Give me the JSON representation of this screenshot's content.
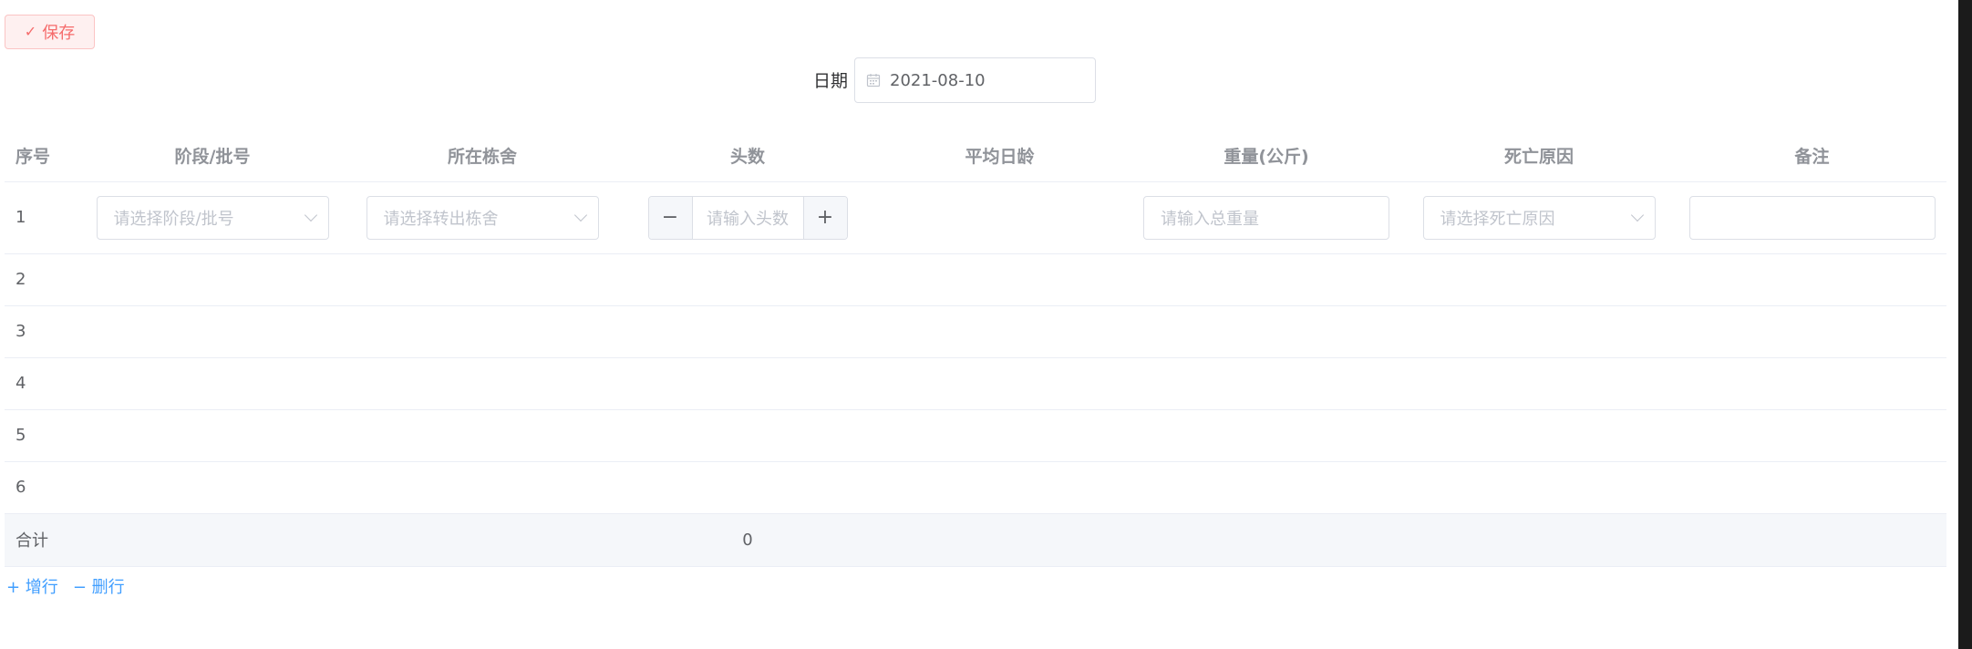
{
  "toolbar": {
    "save_icon": "check-icon",
    "save_label": "保存"
  },
  "date": {
    "label": "日期",
    "value": "2021-08-10",
    "icon": "calendar-icon"
  },
  "table": {
    "headers": [
      "序号",
      "阶段/批号",
      "所在栋舍",
      "头数",
      "平均日龄",
      "重量(公斤)",
      "死亡原因",
      "备注"
    ],
    "rows": [
      {
        "index": "1",
        "stage_placeholder": "请选择阶段/批号",
        "barn_placeholder": "请选择转出栋舍",
        "count_placeholder": "请输入头数",
        "weight_placeholder": "请输入总重量",
        "death_reason_placeholder": "请选择死亡原因",
        "remark": ""
      },
      {
        "index": "2"
      },
      {
        "index": "3"
      },
      {
        "index": "4"
      },
      {
        "index": "5"
      },
      {
        "index": "6"
      }
    ],
    "summary": {
      "label": "合计",
      "count_total": "0"
    }
  },
  "row_actions": {
    "add_label": "+ 增行",
    "delete_label": "− 删行"
  },
  "colors": {
    "primary": "#409eff",
    "danger": "#f56c6c",
    "border": "#dcdfe6"
  }
}
